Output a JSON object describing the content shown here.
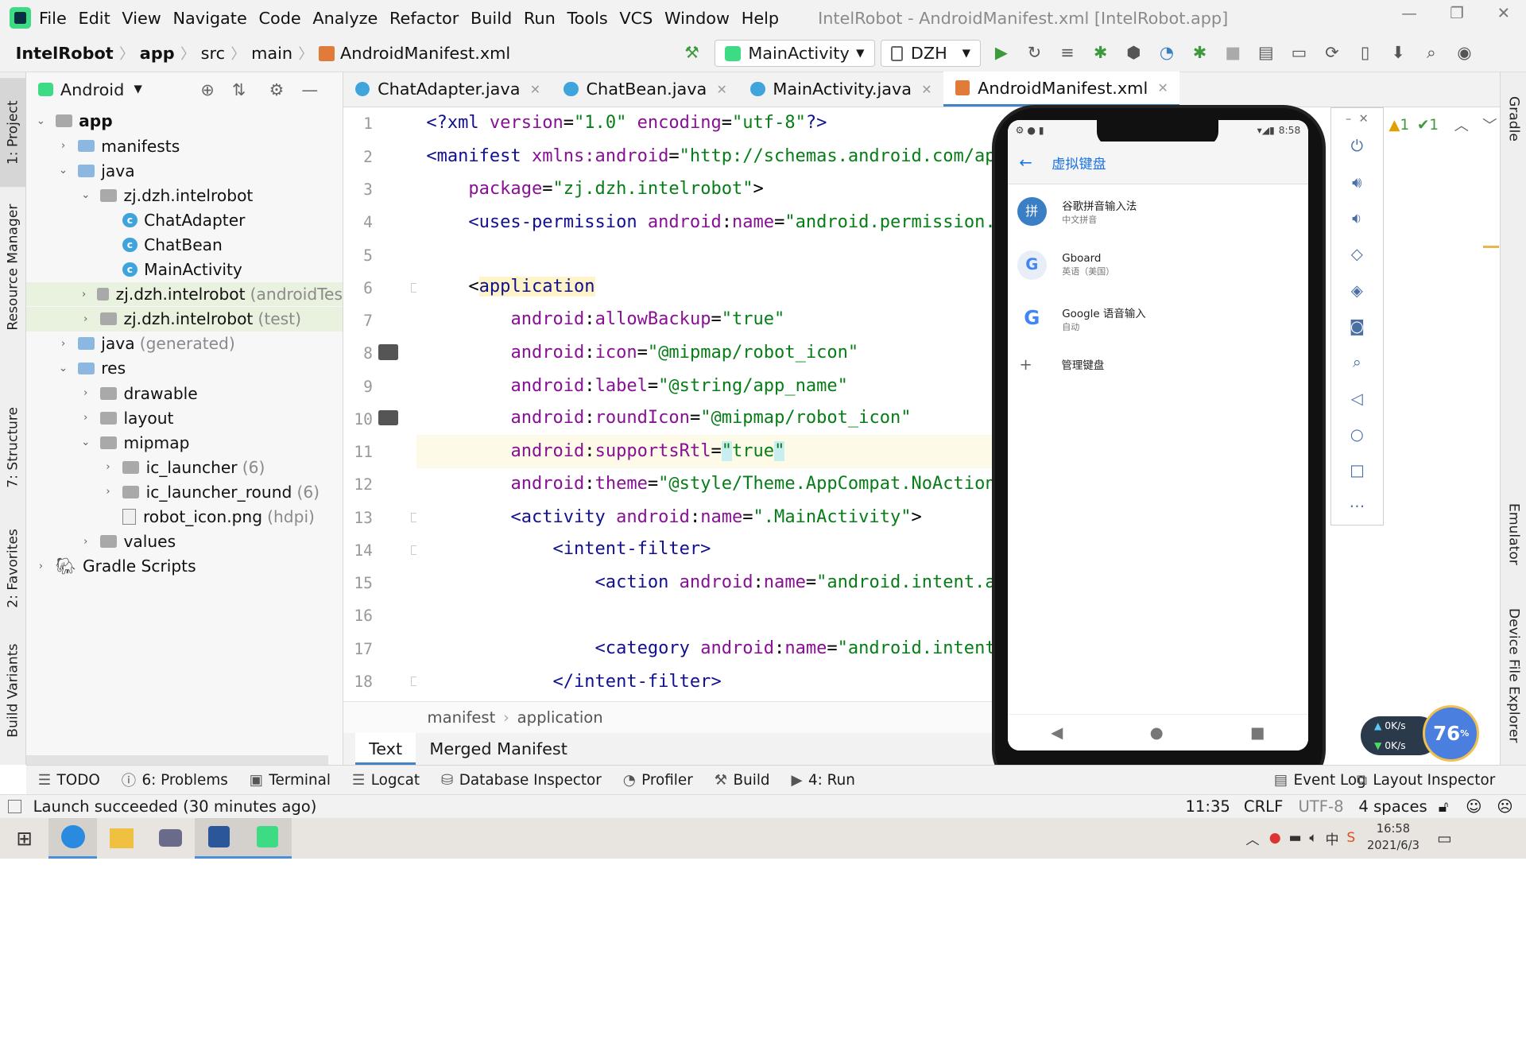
{
  "menu": {
    "items": [
      "File",
      "Edit",
      "View",
      "Navigate",
      "Code",
      "Analyze",
      "Refactor",
      "Build",
      "Run",
      "Tools",
      "VCS",
      "Window",
      "Help"
    ],
    "title": "IntelRobot - AndroidManifest.xml [IntelRobot.app]"
  },
  "nav": {
    "crumbs": [
      "IntelRobot",
      "app",
      "src",
      "main",
      "AndroidManifest.xml"
    ],
    "run_config": "MainActivity",
    "device": "DZH"
  },
  "left_tabs": [
    "1: Project",
    "Resource Manager",
    "7: Structure",
    "2: Favorites",
    "Build Variants"
  ],
  "right_tabs": [
    "Gradle",
    "Emulator",
    "Device File Explorer"
  ],
  "project": {
    "view": "Android",
    "tree": [
      {
        "label": "app",
        "extra": "",
        "depth": 0,
        "arrow": "v",
        "icon": "folder-module",
        "bold": true
      },
      {
        "label": "manifests",
        "extra": "",
        "depth": 1,
        "arrow": ">",
        "icon": "folder"
      },
      {
        "label": "java",
        "extra": "",
        "depth": 1,
        "arrow": "v",
        "icon": "folder"
      },
      {
        "label": "zj.dzh.intelrobot",
        "extra": "",
        "depth": 2,
        "arrow": "v",
        "icon": "package"
      },
      {
        "label": "ChatAdapter",
        "extra": "",
        "depth": 3,
        "arrow": "",
        "icon": "class"
      },
      {
        "label": "ChatBean",
        "extra": "",
        "depth": 3,
        "arrow": "",
        "icon": "class"
      },
      {
        "label": "MainActivity",
        "extra": "",
        "depth": 3,
        "arrow": "",
        "icon": "class"
      },
      {
        "label": "zj.dzh.intelrobot",
        "extra": "(androidTes",
        "depth": 2,
        "arrow": ">",
        "icon": "package",
        "hl": true
      },
      {
        "label": "zj.dzh.intelrobot",
        "extra": "(test)",
        "depth": 2,
        "arrow": ">",
        "icon": "package",
        "hl": true
      },
      {
        "label": "java",
        "extra": "(generated)",
        "depth": 1,
        "arrow": ">",
        "icon": "folder"
      },
      {
        "label": "res",
        "extra": "",
        "depth": 1,
        "arrow": "v",
        "icon": "folder"
      },
      {
        "label": "drawable",
        "extra": "",
        "depth": 2,
        "arrow": ">",
        "icon": "package"
      },
      {
        "label": "layout",
        "extra": "",
        "depth": 2,
        "arrow": ">",
        "icon": "package"
      },
      {
        "label": "mipmap",
        "extra": "",
        "depth": 2,
        "arrow": "v",
        "icon": "package"
      },
      {
        "label": "ic_launcher",
        "extra": "(6)",
        "depth": 3,
        "arrow": ">",
        "icon": "package"
      },
      {
        "label": "ic_launcher_round",
        "extra": "(6)",
        "depth": 3,
        "arrow": ">",
        "icon": "package"
      },
      {
        "label": "robot_icon.png",
        "extra": "(hdpi)",
        "depth": 3,
        "arrow": "",
        "icon": "image"
      },
      {
        "label": "values",
        "extra": "",
        "depth": 2,
        "arrow": ">",
        "icon": "package"
      },
      {
        "label": "Gradle Scripts",
        "extra": "",
        "depth": 0,
        "arrow": ">",
        "icon": "gradle"
      }
    ]
  },
  "editor": {
    "tabs": [
      "ChatAdapter.java",
      "ChatBean.java",
      "MainActivity.java",
      "AndroidManifest.xml"
    ],
    "line_numbers": [
      "1",
      "2",
      "3",
      "4",
      "5",
      "6",
      "7",
      "8",
      "9",
      "10",
      "11",
      "12",
      "13",
      "14",
      "15",
      "16",
      "17",
      "18"
    ],
    "breadcrumb": [
      "manifest",
      "application"
    ],
    "bottom_tabs": [
      "Text",
      "Merged Manifest"
    ],
    "inspection": [
      "1",
      "1"
    ]
  },
  "emulator": {
    "status_time": "8:58",
    "screen_title": "虚拟键盘",
    "items": [
      {
        "name": "谷歌拼音输入法",
        "sub": "中文拼音"
      },
      {
        "name": "Gboard",
        "sub": "英语（美国）"
      },
      {
        "name": "Google 语音输入",
        "sub": "自动"
      }
    ],
    "manage": "管理键盘"
  },
  "speed": {
    "up": "0K/s",
    "down": "0K/s",
    "percent": "76",
    "unit": "%"
  },
  "toolwindows": [
    "TODO",
    "6: Problems",
    "Terminal",
    "Logcat",
    "Database Inspector",
    "Profiler",
    "Build",
    "4: Run",
    "Event Log",
    "Layout Inspector"
  ],
  "status": {
    "message": "Launch succeeded (30 minutes ago)",
    "position": "11:35",
    "line_sep": "CRLF",
    "encoding": "UTF-8",
    "indent": "4 spaces"
  },
  "taskbar": {
    "time": "16:58",
    "date": "2021/6/3"
  }
}
